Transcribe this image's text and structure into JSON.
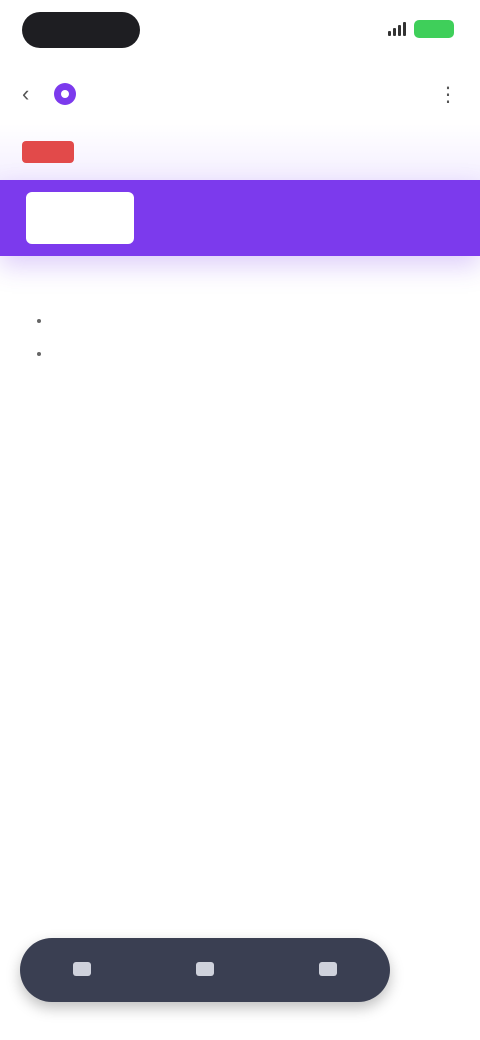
{
  "status_bar": {
    "time": "",
    "battery": ""
  },
  "browser": {
    "url": "",
    "back_icon": "chevron-left-icon",
    "menu_icon": "kebab-menu-icon"
  },
  "site_header": {
    "logo_text": "",
    "header_link": ""
  },
  "banner": {
    "chip_label": ""
  },
  "article": {
    "title": "",
    "paragraphs": [
      "",
      "",
      ""
    ],
    "bullets": [
      "",
      ""
    ]
  },
  "footer": {
    "links": [
      "",
      ""
    ]
  },
  "bottom_bar": {
    "buttons": [
      "",
      "",
      ""
    ],
    "side_action": ""
  },
  "colors": {
    "accent": "#7c3aed",
    "battery": "#3fcf5a",
    "bottom_bar": "#3a3f52"
  }
}
